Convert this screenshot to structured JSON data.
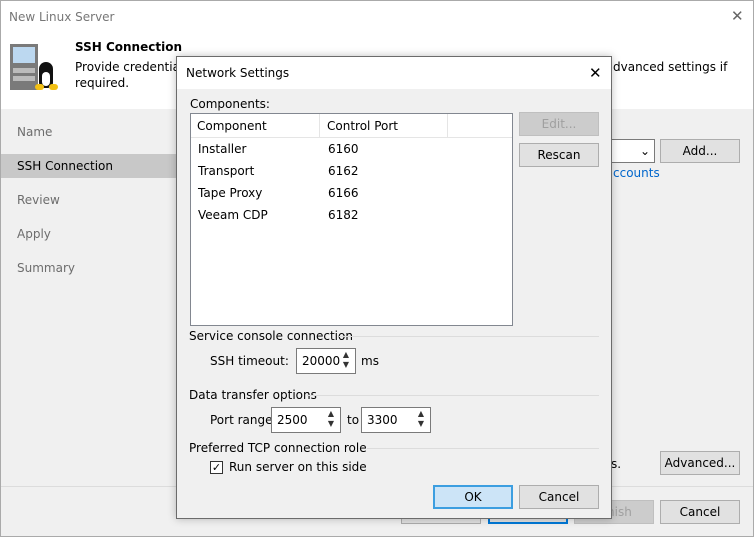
{
  "window": {
    "title": "New Linux Server",
    "close": "✕"
  },
  "header": {
    "title": "SSH Connection",
    "desc_left": "Provide credentials",
    "desc_right": "dvanced settings if",
    "desc_line2": "required."
  },
  "nav": [
    "Name",
    "SSH Connection",
    "Review",
    "Apply",
    "Summary"
  ],
  "background": {
    "add": "Add...",
    "accounts_link": "ccounts",
    "note": "s.",
    "advanced": "Advanced...",
    "finish": "nish",
    "cancel": "Cancel"
  },
  "dialog": {
    "title": "Network Settings",
    "close": "✕",
    "components_label": "Components:",
    "columns": [
      "Component",
      "Control Port"
    ],
    "rows": [
      {
        "name": "Installer",
        "port": "6160"
      },
      {
        "name": "Transport",
        "port": "6162"
      },
      {
        "name": "Tape Proxy",
        "port": "6166"
      },
      {
        "name": "Veeam CDP",
        "port": "6182"
      }
    ],
    "edit": "Edit...",
    "rescan": "Rescan",
    "service_group": "Service console connection",
    "ssh_timeout_label": "SSH timeout:",
    "ssh_timeout": "20000",
    "ms": "ms",
    "data_group": "Data transfer options",
    "port_range_label": "Port range:",
    "port_from": "2500",
    "to": "to",
    "port_to": "3300",
    "tcp_group": "Preferred TCP connection role",
    "run_server": "Run server on this side",
    "run_server_checked": true,
    "ok": "OK",
    "cancel": "Cancel"
  }
}
